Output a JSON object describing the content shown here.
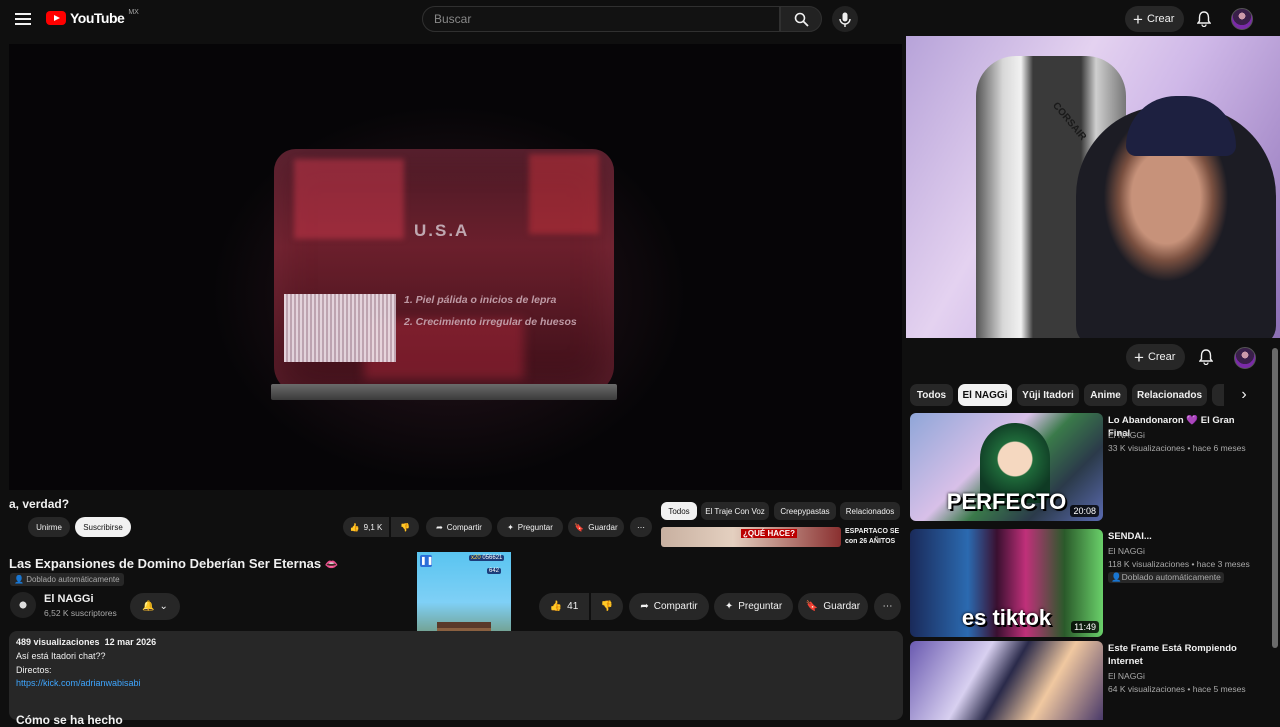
{
  "header": {
    "logo": "YouTube",
    "region": "MX",
    "search_placeholder": "Buscar",
    "create_label": "Crear"
  },
  "player": {
    "screen_heading": "U.S.A",
    "screen_line1": "1. Piel pálida o inicios de lepra",
    "screen_line2": "2. Crecimiento irregular de huesos",
    "overlay_title": "a, verdad?",
    "overlay_join": "Unirme",
    "overlay_subscribe": "Suscribirse",
    "overlay_likes": "9,1 K",
    "overlay_share": "Compartir",
    "overlay_ask": "Preguntar",
    "overlay_save": "Guardar",
    "overlay_chips": [
      "Todos",
      "El Traje Con Voz",
      "Creepypastas",
      "Relacionados"
    ],
    "overlay_related_title": "ESPARTACO SE con 26 AÑITOS",
    "overlay_related_thumb_text": "¿QUÉ HACE?"
  },
  "video": {
    "title": "Las Expansiones de Domino Deberían Ser Eternas",
    "dub_badge": "Doblado automáticamente",
    "channel": "El NAGGi",
    "subscribers": "6,52 K suscriptores",
    "likes": "41",
    "share": "Compartir",
    "ask": "Preguntar",
    "save": "Guardar",
    "views": "489 visualizaciones",
    "date": "12 mar 2026",
    "desc_line1": "Así está Itadori chat??",
    "desc_line2": "Directos:",
    "desc_link": "https://kick.com/adrianwabisabi",
    "desc_cut": "Cómo se ha hecho"
  },
  "gameclip": {
    "coins": "x20",
    "score": "056621",
    "sub_score": "642"
  },
  "sidebar": {
    "create_label": "Crear",
    "chips": [
      "Todos",
      "El NAGGi",
      "Yūji Itadori",
      "Anime",
      "Relacionados"
    ],
    "active_chip": "El NAGGi",
    "items": [
      {
        "title": "Lo Abandonaron 💜 El Gran Final",
        "channel": "El NAGGi",
        "meta": "33 K visualizaciones • hace 6 meses",
        "duration": "20:08",
        "thumb_text": "PERFECTO"
      },
      {
        "title": "SENDAI...",
        "channel": "El NAGGi",
        "meta": "118 K visualizaciones • hace 3 meses",
        "badge": "Doblado automáticamente",
        "duration": "11:49",
        "thumb_text": "es tiktok"
      },
      {
        "title": "Este Frame Está Rompiendo Internet",
        "channel": "El NAGGi",
        "meta": "64 K visualizaciones • hace 5 meses"
      }
    ]
  },
  "webcam": {
    "chair_brand": "CORSAIR"
  },
  "colors": {
    "background": "#0f0f0f",
    "surface": "#272727",
    "accent_red": "#ff0000",
    "lip_emoji_color": "#e0457b"
  }
}
